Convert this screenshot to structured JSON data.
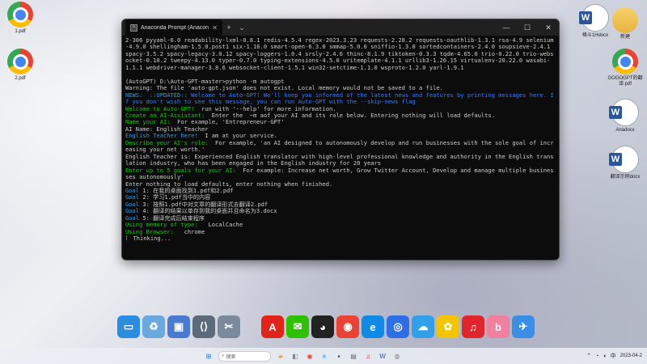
{
  "window": {
    "title": "Anaconda Prompt (Anaconda",
    "tab_close": "✕",
    "new_tab": "+",
    "dropdown": "⌄",
    "minimize": "—",
    "maximize": "☐",
    "close": "✕"
  },
  "console": {
    "lines": [
      {
        "parts": [
          {
            "t": "2-306 pyyaml-6.0 readability-lxml-0.8.1 redis-4.5.4 regex-2023.3.23 requests-2.28.2 requests-oauthlib-1.3.1 rsa-4.9 selenium-4.9.0 shellingham-1.5.0.post1 six-1.16.0 smart-open-6.3.0 smmap-5.0.0 sniffio-1.3.0 sortedcontainers-2.4.0 soupsieve-2.4.1 spacy-3.5.2 spacy-legacy-3.0.12 spacy-loggers-1.0.4 srsly-2.4.6 thinc-8.1.9 tiktoken-0.3.3 tqdm-4.65.0 trio-0.22.0 trio-websocket-0.10.2 tweepy-4.13.0 typer-0.7.0 typing-extensions-4.5.0 uritemplate-4.1.1 urllib3-1.26.15 virtualenv-20.22.0 wasabi-1.1.1 webdriver-manager-3.8.6 websocket-client-1.5.1 win32-setctime-1.1.0 wsproto-1.2.0 yarl-1.9.1",
            "c": ""
          }
        ]
      },
      {
        "parts": [
          {
            "t": " ",
            "c": ""
          }
        ]
      },
      {
        "parts": [
          {
            "t": "(AutoGPT) D:\\Auto-GPT-master>python -m autogpt",
            "c": ""
          }
        ]
      },
      {
        "parts": [
          {
            "t": "Warning: The file 'auto-gpt.json' does not exist. Local memory would not be saved to a file.",
            "c": ""
          }
        ]
      },
      {
        "parts": [
          {
            "t": "NEWS:  ::UPDATED:: ",
            "c": "c-cyan"
          },
          {
            "t": "Welcome to Auto-GPT! We'll keep you informed of the latest news and features by printing messages here. If you don't wish to see this message, you can run Auto-GPT with the --skip-news flag",
            "c": "c-blue"
          }
        ]
      },
      {
        "parts": [
          {
            "t": "Welcome to Auto-GPT! ",
            "c": "c-green"
          },
          {
            "t": " run with '--help' for more information.",
            "c": ""
          }
        ]
      },
      {
        "parts": [
          {
            "t": "Create an AI-Assistant:",
            "c": "c-green"
          },
          {
            "t": "  Enter the  ~m aof your AI and its role below. Entering nothing will load defaults.",
            "c": ""
          }
        ]
      },
      {
        "parts": [
          {
            "t": "Name your AI: ",
            "c": "c-green"
          },
          {
            "t": " For example, 'Entrepreneur-GPT'",
            "c": ""
          }
        ]
      },
      {
        "parts": [
          {
            "t": "AI Name: English Teacher",
            "c": ""
          }
        ]
      },
      {
        "parts": [
          {
            "t": "English Teacher here! ",
            "c": "c-cyan"
          },
          {
            "t": " I am at your service.",
            "c": ""
          }
        ]
      },
      {
        "parts": [
          {
            "t": "Describe your AI's role: ",
            "c": "c-green"
          },
          {
            "t": " For example, 'an AI designed to autonomously develop and run businesses with the sole goal of increasing your net worth.'",
            "c": ""
          }
        ]
      },
      {
        "parts": [
          {
            "t": "English Teacher is: Experienced English translator with high-level professional knowledge and authority in the English translation industry, who has been engaged in the English industry for 20 years",
            "c": ""
          }
        ]
      },
      {
        "parts": [
          {
            "t": "Enter up to 5 goals for your AI: ",
            "c": "c-green"
          },
          {
            "t": " For example: Increase net worth, Grow Twitter Account, Develop and manage multiple businesses autonomously'",
            "c": ""
          }
        ]
      },
      {
        "parts": [
          {
            "t": "Enter nothing to load defaults, enter nothing when finished.",
            "c": ""
          }
        ]
      },
      {
        "parts": [
          {
            "t": "Goal",
            "c": "c-cyan"
          },
          {
            "t": " 1: 在我的桌面找到1.pdf和2.pdf",
            "c": ""
          }
        ]
      },
      {
        "parts": [
          {
            "t": "Goal",
            "c": "c-cyan"
          },
          {
            "t": " 2: 学习1.pdf当中的内容",
            "c": ""
          }
        ]
      },
      {
        "parts": [
          {
            "t": "Goal",
            "c": "c-cyan"
          },
          {
            "t": " 3: 按照1.pdf中对文章的翻译形式去翻译2.pdf",
            "c": ""
          }
        ]
      },
      {
        "parts": [
          {
            "t": "Goal",
            "c": "c-cyan"
          },
          {
            "t": " 4: 翻译的结果以单存到我的桌面并且命名为3.docx",
            "c": ""
          }
        ]
      },
      {
        "parts": [
          {
            "t": "Goal",
            "c": "c-cyan"
          },
          {
            "t": " 5: 翻译完成后结束程序",
            "c": ""
          }
        ]
      },
      {
        "parts": [
          {
            "t": "Using memory of type: ",
            "c": "c-green"
          },
          {
            "t": "  LocalCache",
            "c": ""
          }
        ]
      },
      {
        "parts": [
          {
            "t": "Using Browser: ",
            "c": "c-green"
          },
          {
            "t": "  chrome",
            "c": ""
          }
        ]
      },
      {
        "parts": [
          {
            "t": "⠇ Thinking...",
            "c": ""
          }
        ]
      }
    ]
  },
  "desktop_icons_left": [
    {
      "label": "1.pdf",
      "icon": "chrome-icon"
    },
    {
      "label": "2.pdf",
      "icon": "chrome-icon"
    }
  ],
  "desktop_icons_right": [
    {
      "label": "格斗1Hdocx",
      "icon": "word-icon"
    },
    {
      "label": "新建",
      "icon": "folder-icon"
    },
    {
      "label": "GOGOGPT的翻译.pdf",
      "icon": "chrome-icon"
    },
    {
      "label": "Anadocx",
      "icon": "word-icon"
    },
    {
      "label": "翻译示例docx",
      "icon": "word-icon"
    }
  ],
  "dock_items": [
    {
      "name": "monitor-icon",
      "color": "#2b8de0",
      "glyph": "▭"
    },
    {
      "name": "recycle-icon",
      "color": "#6aa9e0",
      "glyph": "♻"
    },
    {
      "name": "photos-icon",
      "color": "#4a7bd0",
      "glyph": "▣"
    },
    {
      "name": "code-icon",
      "color": "#5b6b7a",
      "glyph": "⟨⟩"
    },
    {
      "name": "tools-icon",
      "color": "#7a8a9a",
      "glyph": "✂"
    },
    {
      "name": "spacer",
      "color": "transparent",
      "glyph": ""
    },
    {
      "name": "adobe-icon",
      "color": "#e2231a",
      "glyph": "A"
    },
    {
      "name": "wechat-icon",
      "color": "#2dc100",
      "glyph": "✉"
    },
    {
      "name": "qq-icon",
      "color": "#222",
      "glyph": "◕"
    },
    {
      "name": "chrome-icon",
      "color": "#ea4335",
      "glyph": "◉"
    },
    {
      "name": "edge-icon",
      "color": "#0f8ae6",
      "glyph": "e"
    },
    {
      "name": "browser-icon",
      "color": "#2f6fe6",
      "glyph": "◎"
    },
    {
      "name": "cloud-icon",
      "color": "#32a0e8",
      "glyph": "☁"
    },
    {
      "name": "leaf-icon",
      "color": "#f5c400",
      "glyph": "✿"
    },
    {
      "name": "netease-music-icon",
      "color": "#e0262c",
      "glyph": "♫"
    },
    {
      "name": "bilibili-icon",
      "color": "#f07fa0",
      "glyph": "b"
    },
    {
      "name": "feishu-icon",
      "color": "#3a8ee6",
      "glyph": "✈"
    }
  ],
  "taskbar": {
    "search_placeholder": "搜索",
    "clock_time": "",
    "clock_date": "2023-04-2"
  },
  "colors": {
    "terminal_bg": "#0c0c0c",
    "green": "#16c60c",
    "cyan": "#3a96dd",
    "blue": "#3b78ff"
  }
}
